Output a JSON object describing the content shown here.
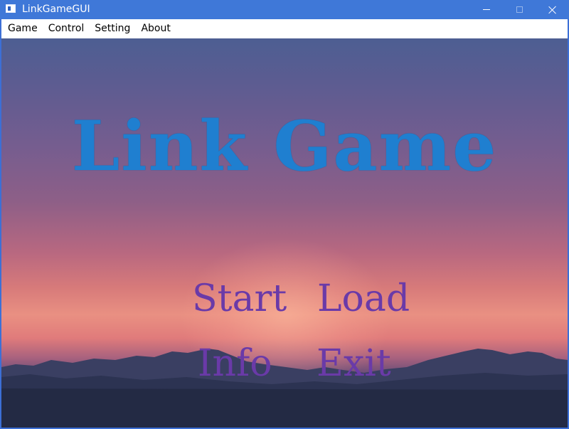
{
  "window": {
    "title": "LinkGameGUI"
  },
  "menubar": {
    "items": [
      {
        "label": "Game"
      },
      {
        "label": "Control"
      },
      {
        "label": "Setting"
      },
      {
        "label": "About"
      }
    ]
  },
  "main": {
    "logo_text": "Link Game",
    "buttons": {
      "start": "Start",
      "load": "Load",
      "info": "Info",
      "exit": "Exit"
    }
  },
  "colors": {
    "titlebar": "#3f78d8",
    "logo": "#1f7fd0",
    "buttons": "#6a3aa8"
  },
  "icons": {
    "app": "app-icon",
    "minimize": "minimize-icon",
    "maximize": "maximize-icon",
    "close": "close-icon"
  }
}
